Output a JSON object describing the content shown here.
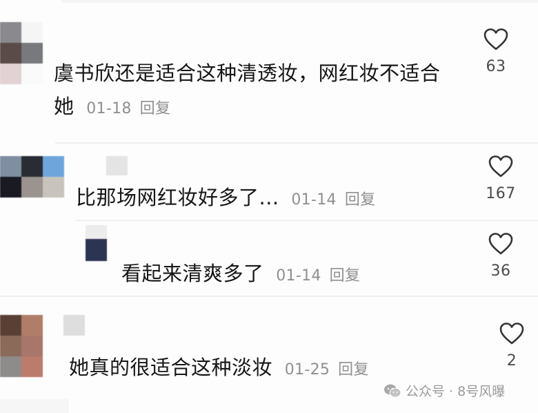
{
  "comments": [
    {
      "text_line1": "虞书欣还是适合这种清透妆，网红妆不适合",
      "text_line2": "她",
      "date": "01-18",
      "reply_label": "回复",
      "likes": "63"
    },
    {
      "text": "比那场网红妆好多了...",
      "date": "01-14",
      "reply_label": "回复",
      "likes": "167"
    },
    {
      "text": "看起来清爽多了",
      "date": "01-14",
      "reply_label": "回复",
      "likes": "36"
    },
    {
      "text": "她真的很适合这种淡妆",
      "date": "01-25",
      "reply_label": "回复",
      "likes": "2"
    }
  ],
  "watermark": {
    "text": "公众号 · 8号风曝"
  },
  "icons": {
    "like": "heart-outline-icon",
    "watermark": "wechat-icon"
  }
}
